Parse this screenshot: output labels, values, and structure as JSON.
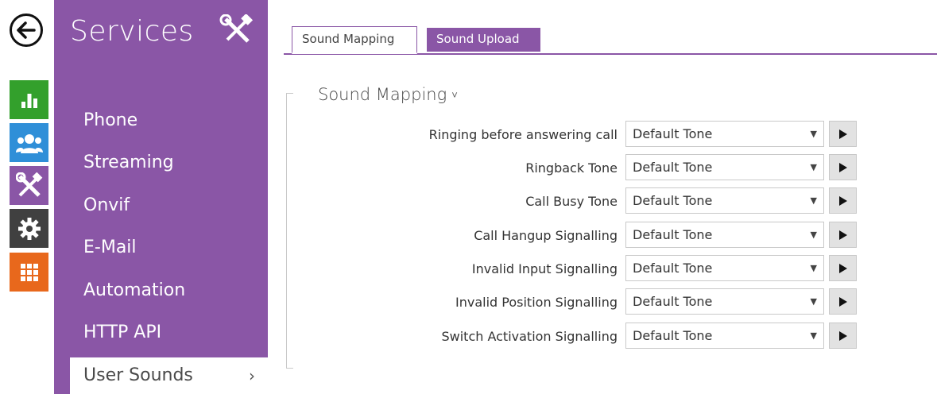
{
  "sidebar": {
    "title": "Services",
    "items": [
      {
        "label": "Phone"
      },
      {
        "label": "Streaming"
      },
      {
        "label": "Onvif"
      },
      {
        "label": "E-Mail"
      },
      {
        "label": "Automation"
      },
      {
        "label": "HTTP API"
      },
      {
        "label": "User Sounds",
        "chevron": "›"
      }
    ]
  },
  "rail": {
    "icons": [
      "back-arrow-icon",
      "status-chart-icon",
      "directory-users-icon",
      "services-tools-icon",
      "hardware-gear-icon",
      "system-grid-icon"
    ],
    "colors": {
      "status": "#33a02c",
      "directory": "#2f8fd8",
      "services": "#8a56a6",
      "hardware": "#404040",
      "system": "#e8681c"
    }
  },
  "tabs": [
    {
      "label": "Sound Mapping"
    },
    {
      "label": "Sound Upload"
    }
  ],
  "section": {
    "title": "Sound Mapping",
    "caret": "˅",
    "rows": [
      {
        "label": "Ringing before answering call",
        "value": "Default Tone"
      },
      {
        "label": "Ringback Tone",
        "value": "Default Tone"
      },
      {
        "label": "Call Busy Tone",
        "value": "Default Tone"
      },
      {
        "label": "Call Hangup Signalling",
        "value": "Default Tone"
      },
      {
        "label": "Invalid Input Signalling",
        "value": "Default Tone"
      },
      {
        "label": "Invalid Position Signalling",
        "value": "Default Tone"
      },
      {
        "label": "Switch Activation Signalling",
        "value": "Default Tone"
      }
    ]
  },
  "theme": {
    "accent": "#8a56a6"
  }
}
